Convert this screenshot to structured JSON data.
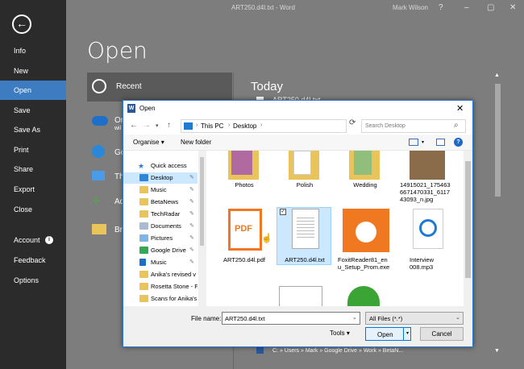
{
  "titlebar": {
    "document": "ART250.d4l.txt",
    "separator": "-",
    "app": "Word",
    "user": "Mark Wilson",
    "help": "?",
    "minimize": "–",
    "restore": "▢",
    "close": "✕"
  },
  "backstage": {
    "back_icon": "←",
    "nav": [
      {
        "label": "Info"
      },
      {
        "label": "New"
      },
      {
        "label": "Open"
      },
      {
        "label": "Save"
      },
      {
        "label": "Save As"
      },
      {
        "label": "Print"
      },
      {
        "label": "Share"
      },
      {
        "label": "Export"
      },
      {
        "label": "Close"
      },
      {
        "label": "Account"
      },
      {
        "label": "Feedback"
      },
      {
        "label": "Options"
      }
    ],
    "selected_nav": "Open",
    "account_info_icon": "i",
    "title": "Open",
    "places": [
      {
        "label": "Recent"
      },
      {
        "label": "On"
      },
      {
        "label": "wil"
      },
      {
        "label": "Go"
      },
      {
        "label": "Th"
      },
      {
        "label": "Ad"
      },
      {
        "label": "Br"
      }
    ],
    "recent_heading": "Today",
    "recent_partial_1": "ART250.d4l.txt",
    "recent_path": "C: » Users » Mark » Google Drive » Work » BetaN..."
  },
  "dialog": {
    "title": "Open",
    "app_icon": "W",
    "close": "✕",
    "address": {
      "crumbs": [
        "This PC",
        "Desktop"
      ],
      "search_placeholder": "Search Desktop"
    },
    "commands": {
      "organise": "Organise",
      "new_folder": "New folder",
      "help": "?"
    },
    "tree": [
      {
        "label": "Quick access"
      },
      {
        "label": "Desktop"
      },
      {
        "label": "Music"
      },
      {
        "label": "BetaNews"
      },
      {
        "label": "TechRadar"
      },
      {
        "label": "Documents"
      },
      {
        "label": "Pictures"
      },
      {
        "label": "Google Drive"
      },
      {
        "label": "Music"
      },
      {
        "label": "Anika's revised v"
      },
      {
        "label": "Rosetta Stone - F"
      },
      {
        "label": "Scans for Anika's"
      }
    ],
    "files_row1": [
      {
        "name": "Photos"
      },
      {
        "name": "Polish"
      },
      {
        "name": "Wedding"
      },
      {
        "name": "14915021_175463\n6671470331_6117\n43093_n.jpg"
      }
    ],
    "files_row2": [
      {
        "name": "ART250.d4l.pdf"
      },
      {
        "name": "ART250.d4l.txt"
      },
      {
        "name": "FoxitReader81_en\nu_Setup_Prom.exe"
      },
      {
        "name": "Interview\n008.mp3"
      }
    ],
    "pdf_badge": "PDF",
    "file_name_label": "File name:",
    "file_name_value": "ART250.d4l.txt",
    "file_type_value": "All Files (*.*)",
    "tools": "Tools",
    "open_button": "Open",
    "cancel_button": "Cancel"
  }
}
